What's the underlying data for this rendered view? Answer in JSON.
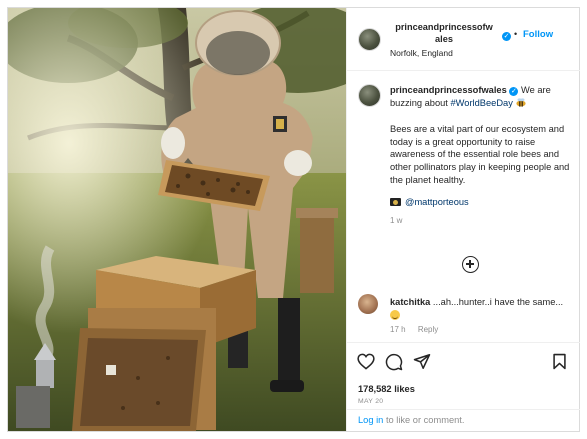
{
  "post": {
    "username_line1": "princeandprincessofw",
    "username_line2": "ales",
    "follow_dot": "•",
    "follow_label": "Follow",
    "location": "Norfolk, England",
    "verified_mark": "✓"
  },
  "caption": {
    "username": "princeandprincessofwales",
    "intro": "We are buzzing about",
    "hashtag": "#WorldBeeDay",
    "body": "Bees are a vital part of our ecosystem and today is a great opportunity to raise awareness of the essential role bees and other pollinators play in keeping people and the planet healthy.",
    "credit": "@mattporteous",
    "time": "1 w"
  },
  "comment": {
    "username": "katchitka",
    "text": "...ah...hunter..i have the same...",
    "time": "17 h",
    "reply_label": "Reply"
  },
  "engagement": {
    "likes": "178,582 likes",
    "date": "MAY 20"
  },
  "login": {
    "link": "Log in",
    "rest": "to like or comment."
  },
  "icons": [
    "heart-icon",
    "comment-icon",
    "share-icon",
    "bookmark-icon",
    "add-comment-icon",
    "camera-icon",
    "bee-icon",
    "smile-emoji-icon",
    "verified-icon"
  ],
  "colors": {
    "accent": "#0095f6",
    "text": "#262626",
    "muted": "#8e8e8e",
    "hashtag": "#00376b"
  }
}
